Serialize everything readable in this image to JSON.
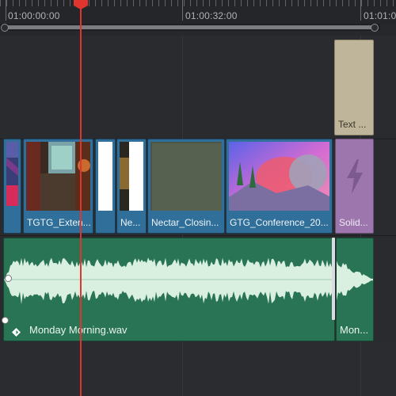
{
  "ruler": {
    "timecodes": [
      "01:00:00:00",
      "01:00:32:00",
      "01:01:0"
    ]
  },
  "tracks": {
    "title": {
      "clips": [
        {
          "label": "Text ..."
        }
      ]
    },
    "video": {
      "clips": [
        {
          "label": ""
        },
        {
          "label": "TGTG_Exten..."
        },
        {
          "label": ""
        },
        {
          "label": "Ne..."
        },
        {
          "label": "Nectar_Closin..."
        },
        {
          "label": "GTG_Conference_20..."
        },
        {
          "label": "Solid..."
        }
      ]
    },
    "audio": {
      "clips": [
        {
          "label": "Monday Morning.wav",
          "icon": "audio-clip-icon"
        },
        {
          "label": "Mon..."
        }
      ]
    }
  },
  "colors": {
    "video_clip": "#2f6f99",
    "audio_clip": "#2a7456",
    "text_clip": "#bfb59a",
    "solid_clip": "#9d76ad",
    "playhead": "#e0342e"
  }
}
